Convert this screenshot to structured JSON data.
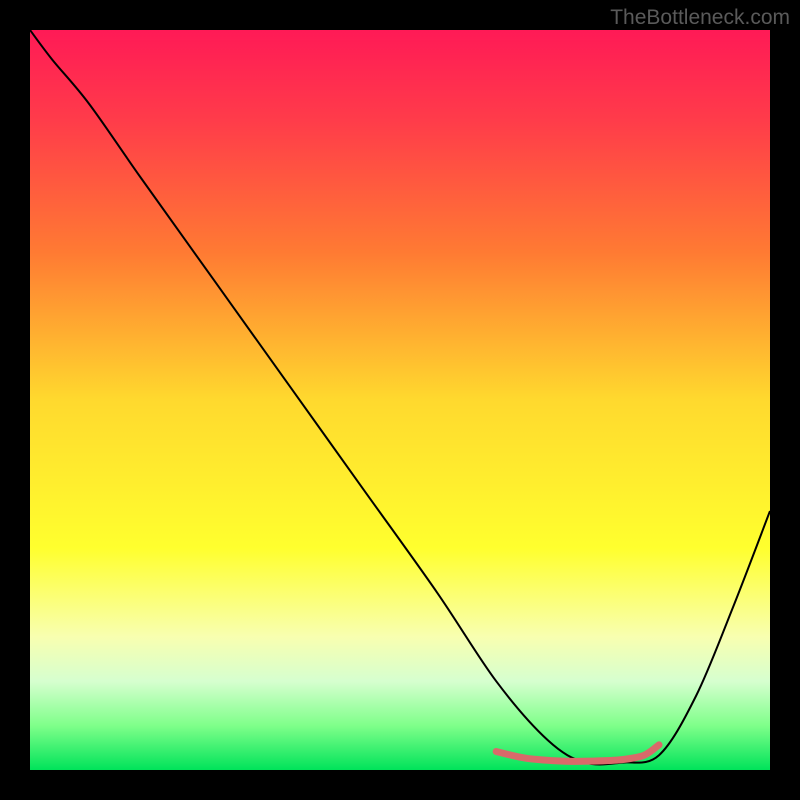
{
  "watermark": "TheBottleneck.com",
  "chart_data": {
    "type": "line",
    "title": "",
    "xlabel": "",
    "ylabel": "",
    "xlim": [
      0,
      100
    ],
    "ylim": [
      0,
      100
    ],
    "background_gradient": {
      "stops": [
        {
          "offset": 0.0,
          "color": "#ff1a56"
        },
        {
          "offset": 0.12,
          "color": "#ff3b4a"
        },
        {
          "offset": 0.3,
          "color": "#ff7a33"
        },
        {
          "offset": 0.5,
          "color": "#ffd92e"
        },
        {
          "offset": 0.7,
          "color": "#ffff2e"
        },
        {
          "offset": 0.82,
          "color": "#f8ffb0"
        },
        {
          "offset": 0.88,
          "color": "#d6ffcf"
        },
        {
          "offset": 0.94,
          "color": "#7fff8a"
        },
        {
          "offset": 1.0,
          "color": "#00e35a"
        }
      ]
    },
    "series": [
      {
        "name": "bottleneck-curve",
        "stroke": "#000000",
        "stroke_width": 2,
        "x": [
          0,
          3,
          8,
          15,
          25,
          35,
          45,
          55,
          63,
          70,
          75,
          80,
          85,
          90,
          95,
          100
        ],
        "y": [
          100,
          96,
          90,
          80,
          66,
          52,
          38,
          24,
          12,
          4,
          1,
          1,
          2,
          10,
          22,
          35
        ]
      }
    ],
    "highlight_segment": {
      "name": "optimal-range",
      "stroke": "#d96a6a",
      "stroke_width": 7,
      "x": [
        63,
        67,
        72,
        76,
        80,
        83,
        85
      ],
      "y": [
        2.5,
        1.6,
        1.2,
        1.2,
        1.4,
        2.0,
        3.4
      ]
    }
  }
}
